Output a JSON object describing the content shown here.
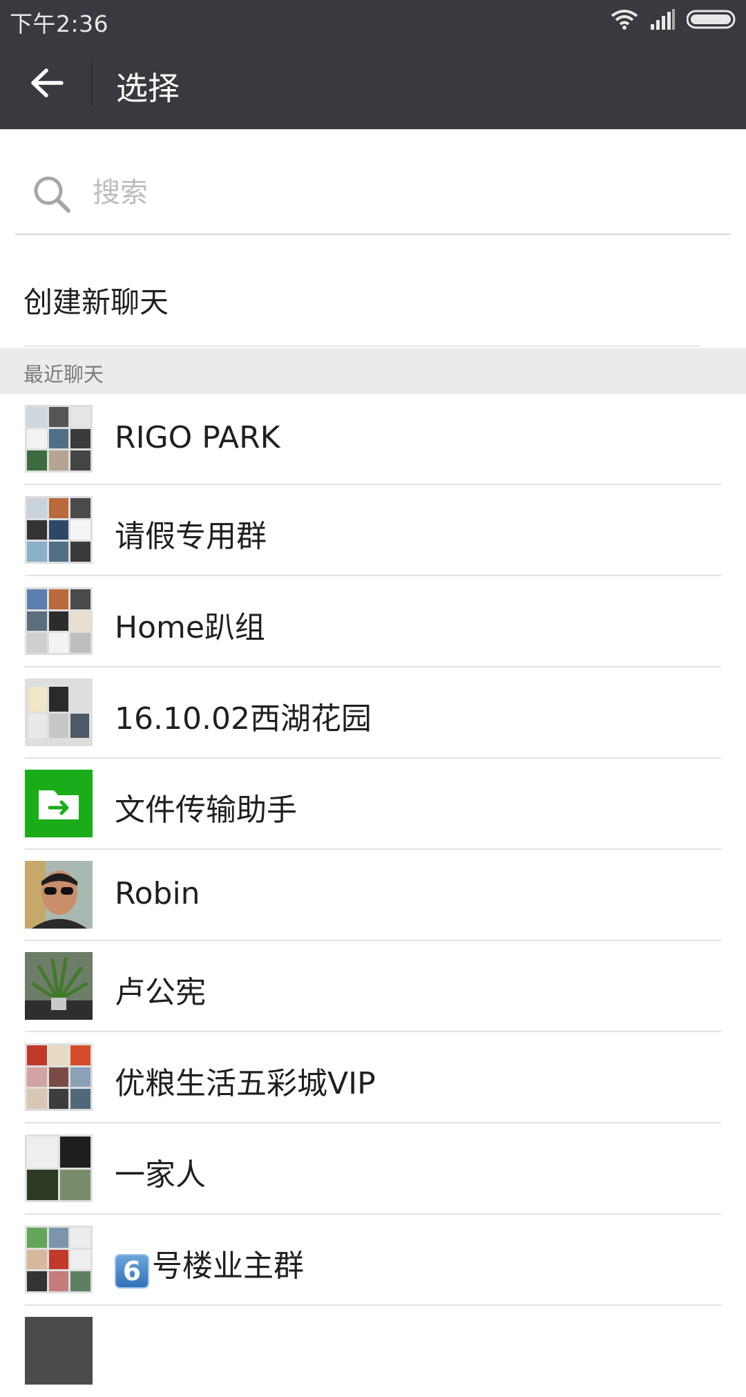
{
  "status_bar": {
    "time": "下午2:36"
  },
  "app_bar": {
    "title": "选择"
  },
  "search": {
    "placeholder": "搜索"
  },
  "create_chat": {
    "label": "创建新聊天"
  },
  "recent": {
    "header": "最近聊天",
    "chats": [
      {
        "name": "RIGO PARK",
        "avatar": "group-avatar-grid"
      },
      {
        "name": "请假专用群",
        "avatar": "group-avatar-grid"
      },
      {
        "name": "Home趴组",
        "avatar": "group-avatar-grid"
      },
      {
        "name": "16.10.02西湖花园",
        "avatar": "group-avatar-small-grid"
      },
      {
        "name": "文件传输助手",
        "avatar": "file-transfer-icon"
      },
      {
        "name": "Robin",
        "avatar": "person-photo"
      },
      {
        "name": "卢公宪",
        "avatar": "plant-photo"
      },
      {
        "name": "优粮生活五彩城VIP",
        "avatar": "group-avatar-grid"
      },
      {
        "name": "一家人",
        "avatar": "group-avatar-grid"
      },
      {
        "badge": "6",
        "name_suffix": "号楼业主群",
        "avatar": "group-avatar-grid"
      }
    ]
  },
  "colors": {
    "header_bg": "#393a3f",
    "accent_green": "#1aad19",
    "section_bg": "#ebebeb"
  }
}
